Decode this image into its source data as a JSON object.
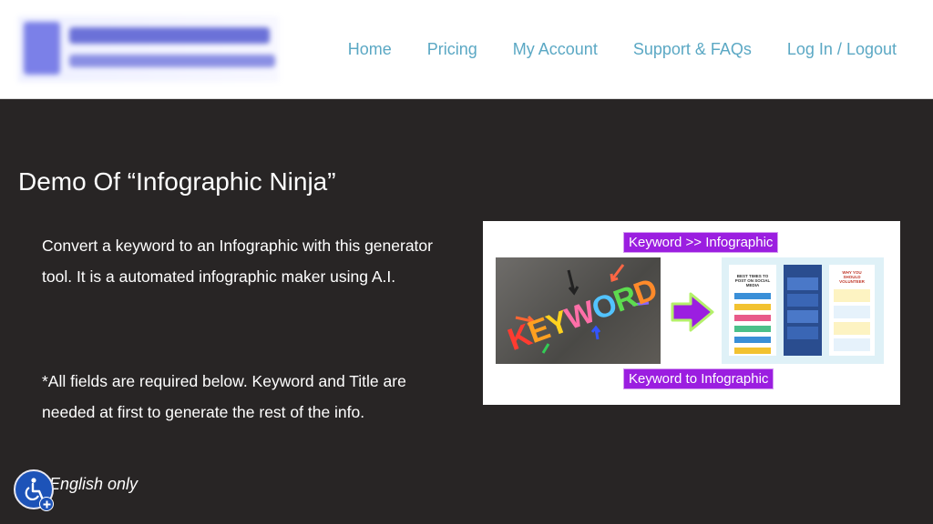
{
  "nav": {
    "items": [
      "Home",
      "Pricing",
      "My Account",
      "Support & FAQs",
      "Log In / Logout"
    ]
  },
  "main": {
    "title": "Demo Of “Infographic Ninja”",
    "paragraph1": "Convert a keyword to an Infographic with this generator tool. It is a automated infographic maker using A.I.",
    "paragraph2": "*All fields are required below. Keyword and Title are needed at first to generate the rest of the info.",
    "note": "English only"
  },
  "image": {
    "label_top": "Keyword >> Infographic",
    "label_bottom": "Keyword to Infographic",
    "keyword_letters": [
      "K",
      "E",
      "Y",
      "W",
      "O",
      "R",
      "D"
    ],
    "infographic_title": "BEST TIMES TO POST ON SOCIAL MEDIA",
    "infographic_right_title": "WHY YOU SHOULD VOLUNTEER"
  },
  "colors": {
    "background": "#282525",
    "nav_link": "#5ba8c4",
    "label_purple": "#9b1ee0",
    "accessibility_blue": "#1d53b8"
  }
}
